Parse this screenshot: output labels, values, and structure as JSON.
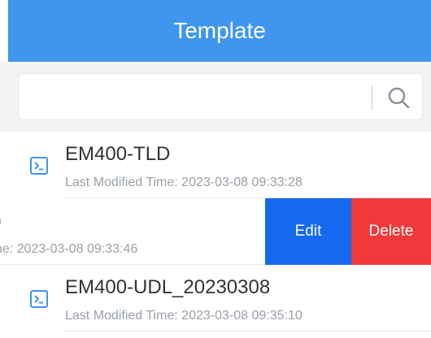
{
  "header": {
    "title": "Template"
  },
  "search": {
    "value": "",
    "placeholder": ""
  },
  "templates": [
    {
      "name": "EM400-TLD",
      "meta": "Last Modified Time: 2023-03-08 09:33:28"
    },
    {
      "name": ")",
      "meta": "ne: 2023-03-08 09:33:46"
    },
    {
      "name": "EM400-UDL_20230308",
      "meta": "Last Modified Time: 2023-03-08 09:35:10"
    }
  ],
  "swipe_actions": {
    "edit_label": "Edit",
    "delete_label": "Delete"
  },
  "colors": {
    "header": "#3f96ef",
    "edit": "#1668f0",
    "delete": "#f0393b",
    "icon": "#3f96ef"
  },
  "icons": {
    "search": "search-icon",
    "item": "template-file-icon"
  }
}
